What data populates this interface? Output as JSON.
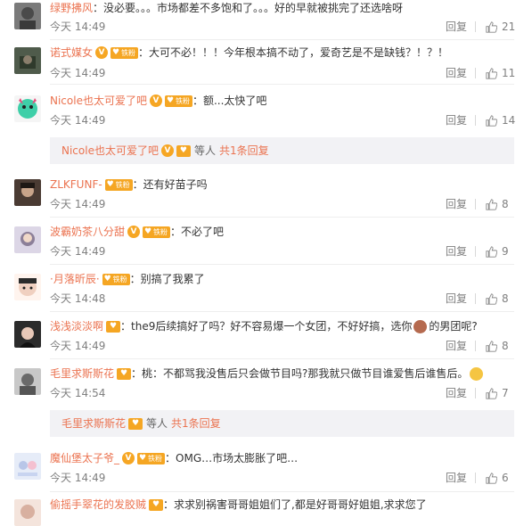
{
  "comments": [
    {
      "name": "绿野拂风",
      "badges": [],
      "text": "：没必要。。。市场都差不多饱和了。。。好的早就被挑完了还选啥呀",
      "time": "今天 14:49",
      "reply": "回复",
      "likes": "21",
      "avatar_color": "#6b6b6b"
    },
    {
      "name": "诺式媒女",
      "badges": [
        "v",
        "fan"
      ],
      "text": "：大可不必！！！今年根本搞不动了，爱奇艺是不是缺钱？！？！",
      "time": "今天 14:49",
      "reply": "回复",
      "likes": "11",
      "avatar_color": "#3d4a3a"
    },
    {
      "name": "Nicole也太可爱了吧",
      "badges": [
        "v",
        "fan"
      ],
      "text": "：额...太快了吧",
      "time": "今天 14:49",
      "reply": "回复",
      "likes": "14",
      "avatar_color": "#3ecfa8"
    },
    {
      "name": "ZLKFUNF-",
      "badges": [
        "fan"
      ],
      "text": "：还有好苗子吗",
      "time": "今天 14:49",
      "reply": "回复",
      "likes": "8",
      "avatar_color": "#4a3b33"
    },
    {
      "name": "波霸奶茶八分甜",
      "badges": [
        "v",
        "fan"
      ],
      "text": "：不必了吧",
      "time": "今天 14:49",
      "reply": "回复",
      "likes": "9",
      "avatar_color": "#8c7f98"
    },
    {
      "name": "·月落昕辰·",
      "badges": [
        "fan"
      ],
      "text": "：别搞了我累了",
      "time": "今天 14:48",
      "reply": "回复",
      "likes": "8",
      "avatar_color": "#f0d0c0"
    },
    {
      "name": "浅浅淡淡啊",
      "badges": [
        "vheart"
      ],
      "text_before": "：the9后续搞好了吗？好不容易爆一个女团，不好好搞，选你",
      "text_after": "的男团呢?",
      "time": "今天 14:49",
      "reply": "回复",
      "likes": "8",
      "avatar_color": "#2b2b2b"
    },
    {
      "name": "毛里求斯斯花",
      "badges": [
        "vheart"
      ],
      "text": "：桃：不都骂我没售后只会做节目吗?那我就只做节目谁爱售后谁售后。",
      "time": "今天 14:54",
      "reply": "回复",
      "likes": "7",
      "avatar_color": "#9a9a9a"
    },
    {
      "name": "魔仙堡太子爷_",
      "badges": [
        "v",
        "fan"
      ],
      "text": "：OMG…市场太膨胀了吧…",
      "time": "今天 14:49",
      "reply": "回复",
      "likes": "6",
      "avatar_color": "#b8c6e8"
    },
    {
      "name": "偷摇手翠花的发胶贼",
      "badges": [
        "vheart"
      ],
      "text": "：求求别祸害哥哥姐姐们了,都是好哥哥好姐姐,求求您了",
      "time": "",
      "reply": "",
      "likes": "",
      "avatar_color": "#d8b0a0"
    }
  ],
  "subreplies": [
    {
      "name": "Nicole也太可爱了吧",
      "suffix": "等人",
      "count": "共1条回复"
    },
    {
      "name": "毛里求斯斯花",
      "suffix": "等人",
      "count": "共1条回复"
    }
  ],
  "badge_text": {
    "v": "V",
    "fan": "铁粉",
    "vheart": "♥"
  },
  "icons": {
    "like": "thumbs-up-icon",
    "avatar": "user-avatar"
  }
}
